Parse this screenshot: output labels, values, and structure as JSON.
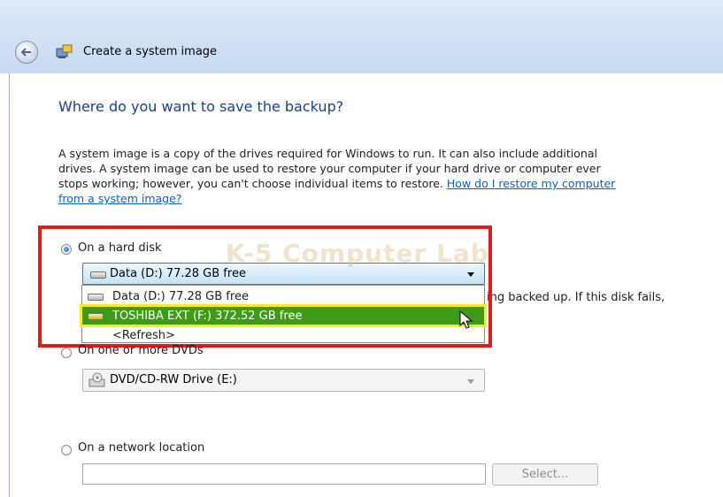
{
  "window": {
    "title": "Create a system image"
  },
  "main": {
    "heading": "Where do you want to save the backup?",
    "description": {
      "line1": "A system image is a copy of the drives required for Windows to run. It can also include additional",
      "line2": "drives. A system image can be used to restore your computer if your hard drive or computer ever",
      "line3": "stops working; however, you can't choose individual items to restore. ",
      "link_part1": "How do I restore my computer",
      "link_part2": "from a system image?"
    }
  },
  "options": {
    "hard_disk": {
      "label": "On a hard disk",
      "selected_value": "Data (D:)  77.28 GB free",
      "dropdown_items": [
        "Data (D:)  77.28 GB free",
        "TOSHIBA EXT (F:)  372.52 GB free",
        "<Refresh>"
      ],
      "highlighted_index": 1,
      "partial_text": "ing backed up. If this disk fails,"
    },
    "dvd": {
      "label": "On one or more DVDs",
      "selected_value": "DVD/CD-RW Drive (E:)"
    },
    "network": {
      "label": "On a network location",
      "input_value": "",
      "select_button_label": "Select..."
    }
  },
  "watermark": "K-5 Computer Lab",
  "colors": {
    "heading": "#1e3f8a",
    "link": "#0b5ec9",
    "highlight": "#3d9b19",
    "annotation_box": "#e21b1b"
  }
}
